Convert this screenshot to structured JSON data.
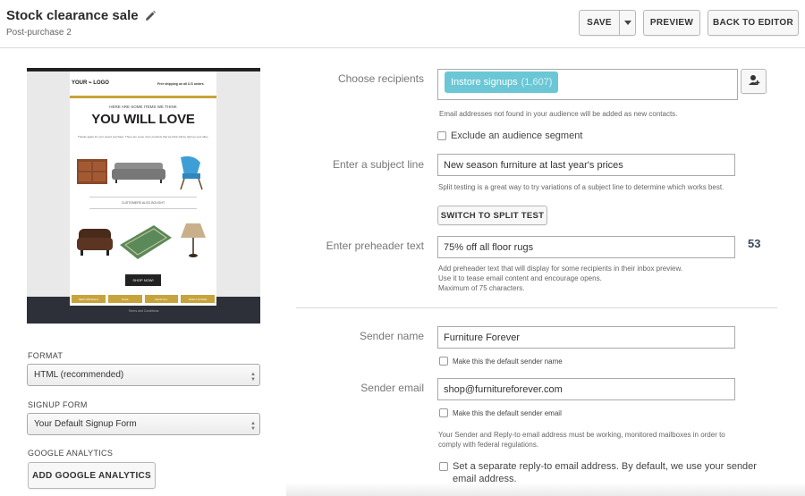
{
  "header": {
    "title": "Stock clearance sale",
    "subtitle": "Post-purchase 2",
    "save_label": "SAVE",
    "preview_label": "PREVIEW",
    "back_label": "BACK TO EDITOR"
  },
  "email_preview": {
    "logo_text": "YOUR ⌁ LOGO",
    "shipping_text": "Free shipping on all U.S orders",
    "intro_small": "HERE ARE SOME ITEMS WE THINK",
    "headline": "YOU WILL LOVE",
    "thanks_text": "Thanks again for your recent purchase. There are some more products that we think will be right up your alley.",
    "also_bought": "CUSTOMERS ALSO BOUGHT",
    "shop_button": "SHOP NOW!",
    "nav_items": [
      "NEW ARRIVALS",
      "SALE",
      "SHOP ALL",
      "FIND A STORE"
    ],
    "terms": "Terms and Conditions"
  },
  "left_form": {
    "format_label": "FORMAT",
    "format_value": "HTML (recommended)",
    "signup_label": "SIGNUP FORM",
    "signup_value": "Your Default Signup Form",
    "ga_label": "GOOGLE ANALYTICS",
    "ga_button": "ADD GOOGLE ANALYTICS"
  },
  "recipients": {
    "label": "Choose recipients",
    "tag_name": "Instore signups",
    "tag_count": "(1,607)",
    "help": "Email addresses not found in your audience will be added as new contacts.",
    "exclude_label": "Exclude an audience segment"
  },
  "subject": {
    "label": "Enter a subject line",
    "value": "New season furniture at last year's prices",
    "help": "Split testing is a great way to try variations of a subject line to determine which works best.",
    "split_button": "SWITCH TO SPLIT TEST"
  },
  "preheader": {
    "label": "Enter preheader text",
    "value": "75% off all floor rugs",
    "count": "53",
    "help_lines": [
      "Add preheader text that will display for some recipients in their inbox preview.",
      "Use it to tease email content and encourage opens.",
      "Maximum of 75 characters."
    ]
  },
  "sender": {
    "name_label": "Sender name",
    "name_value": "Furniture Forever",
    "name_default": "Make this the default sender name",
    "email_label": "Sender email",
    "email_value": "shop@furnitureforever.com",
    "email_default": "Make this the default sender email",
    "policy": "Your Sender and Reply-to email address must be working, monitored mailboxes in order to comply with federal regulations.",
    "reply_to": "Set a separate reply-to email address. By default, we use your sender email address."
  },
  "colors": {
    "tag_bg": "#6bc7d5",
    "accent_gold": "#c7a33b",
    "count_color": "#3a4a5c"
  }
}
